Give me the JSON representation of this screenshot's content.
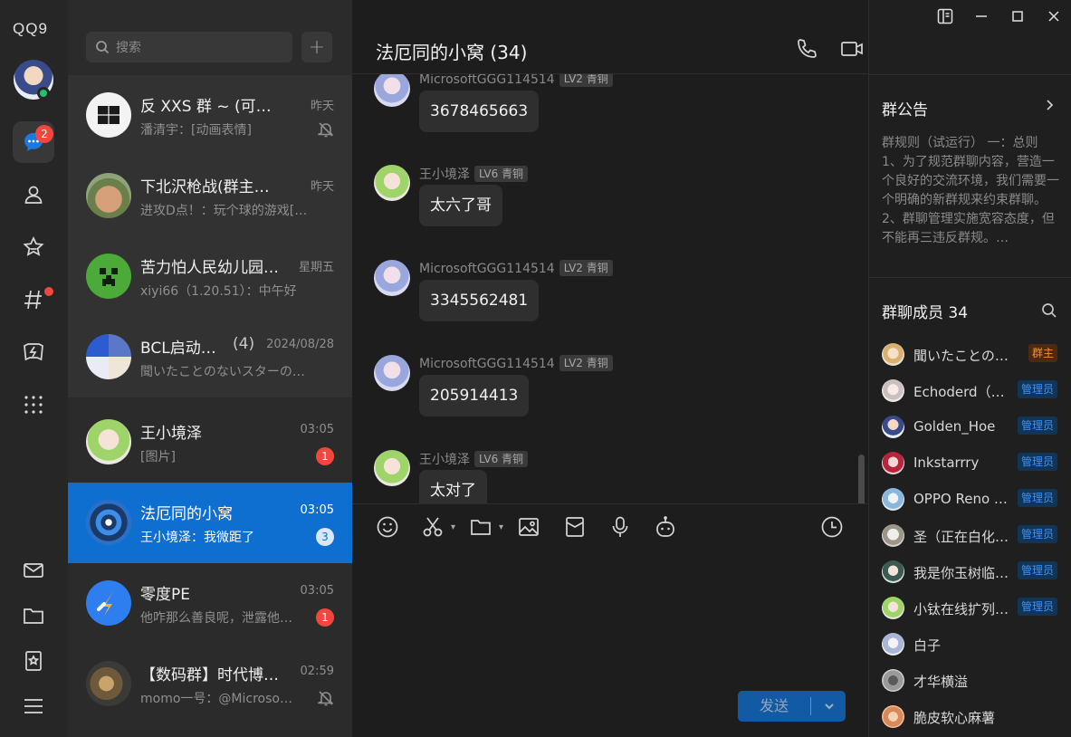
{
  "app": {
    "logo": "QQ9"
  },
  "rail": {
    "messages_badge": "2"
  },
  "search": {
    "placeholder": "搜索"
  },
  "conversations": [
    {
      "name": "反 XXS 群 ~ (可闲聊)",
      "time": "昨天",
      "preview": "潘清宇：[动画表情]",
      "muted": true
    },
    {
      "name": "下北沢枪战(群主有…",
      "time": "昨天",
      "preview": "进攻D点！：玩个球的游戏[…"
    },
    {
      "name": "苦力怕人民幼儿园…",
      "time": "星期五",
      "preview": "xiyi66（1.20.51）：中午好"
    },
    {
      "name": "BCL启动…",
      "count": "(4)",
      "time": "2024/08/28",
      "preview": "聞いたことのないスターの…"
    },
    {
      "name": "王小境泽",
      "time": "03:05",
      "preview": "[图片]",
      "badge": "1"
    },
    {
      "name": "法厄同的小窝",
      "time": "03:05",
      "preview": "王小境泽：我微距了",
      "badge": "3"
    },
    {
      "name": "零度PE",
      "time": "03:05",
      "preview": "他咋那么善良呢，泄露他…",
      "badge": "1"
    },
    {
      "name": "【数码群】时代博…",
      "time": "02:59",
      "preview": "momo一号：@Microso…",
      "muted": true
    }
  ],
  "chat": {
    "title": "法厄同的小窝 (34)",
    "messages": [
      {
        "sender": "MicrosoftGGG114514",
        "level": "LV2 青铜",
        "text": "3678465663"
      },
      {
        "sender": "王小境泽",
        "level": "LV6 青铜",
        "text": "太六了哥"
      },
      {
        "sender": "MicrosoftGGG114514",
        "level": "LV2 青铜",
        "text": "3345562481"
      },
      {
        "sender": "MicrosoftGGG114514",
        "level": "LV2 青铜",
        "text": "205914413"
      },
      {
        "sender": "王小境泽",
        "level": "LV6 青铜",
        "text": "太对了"
      }
    ],
    "send_label": "发送"
  },
  "side": {
    "notice_title": "群公告",
    "notice_text": "群规则（试运行） 一：总则 1、为了规范群聊内容，营造一个良好的交流环境，我们需要一个明确的新群规来约束群聊。 2、群聊管理实施宽容态度，但不能再三违反群规。…",
    "members_title": "群聊成员 34",
    "members": [
      {
        "name": "聞いたことの…",
        "role": "群主",
        "type": "owner"
      },
      {
        "name": "Echoderd（…",
        "role": "管理员",
        "type": "admin"
      },
      {
        "name": "Golden_Hoe",
        "role": "管理员",
        "type": "admin"
      },
      {
        "name": "Inkstarrry",
        "role": "管理员",
        "type": "admin"
      },
      {
        "name": "OPPO Reno …",
        "role": "管理员",
        "type": "admin"
      },
      {
        "name": "圣（正在白化…",
        "role": "管理员",
        "type": "admin"
      },
      {
        "name": "我是你玉树临…",
        "role": "管理员",
        "type": "admin"
      },
      {
        "name": "小钛在线扩列…",
        "role": "管理员",
        "type": "admin"
      },
      {
        "name": "白子",
        "role": "",
        "type": ""
      },
      {
        "name": "才华横溢",
        "role": "",
        "type": ""
      },
      {
        "name": "脆皮软心麻薯",
        "role": "",
        "type": ""
      }
    ]
  }
}
